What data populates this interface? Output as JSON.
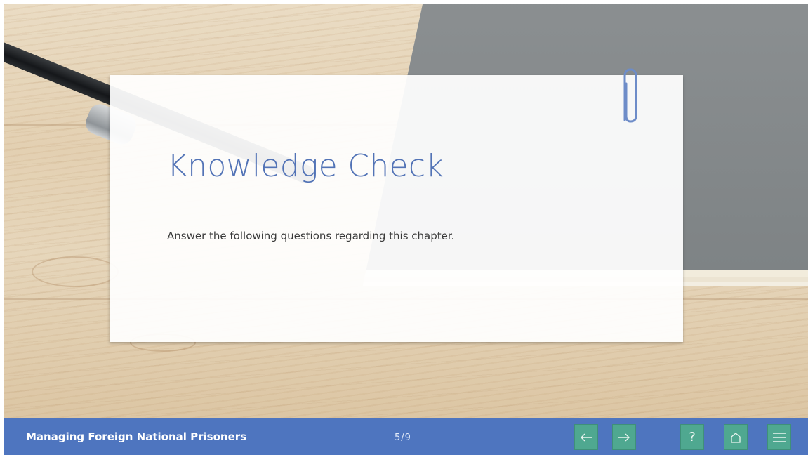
{
  "slide": {
    "title": "Knowledge Check",
    "instructions": "Answer the following questions regarding this chapter."
  },
  "footer": {
    "course_title": "Managing Foreign National Prisoners",
    "page_indicator": "5/9",
    "buttons": {
      "prev": {
        "icon": "arrow-left-icon"
      },
      "next": {
        "icon": "arrow-right-icon"
      },
      "help": {
        "icon": "question-mark-icon",
        "label": "?"
      },
      "home": {
        "icon": "home-icon"
      },
      "menu": {
        "icon": "hamburger-menu-icon"
      }
    }
  },
  "colors": {
    "accent_blue": "#4e75bf",
    "title_blue": "#5273b6",
    "button_green": "#4fa890",
    "paperclip": "#6d8cc8"
  }
}
